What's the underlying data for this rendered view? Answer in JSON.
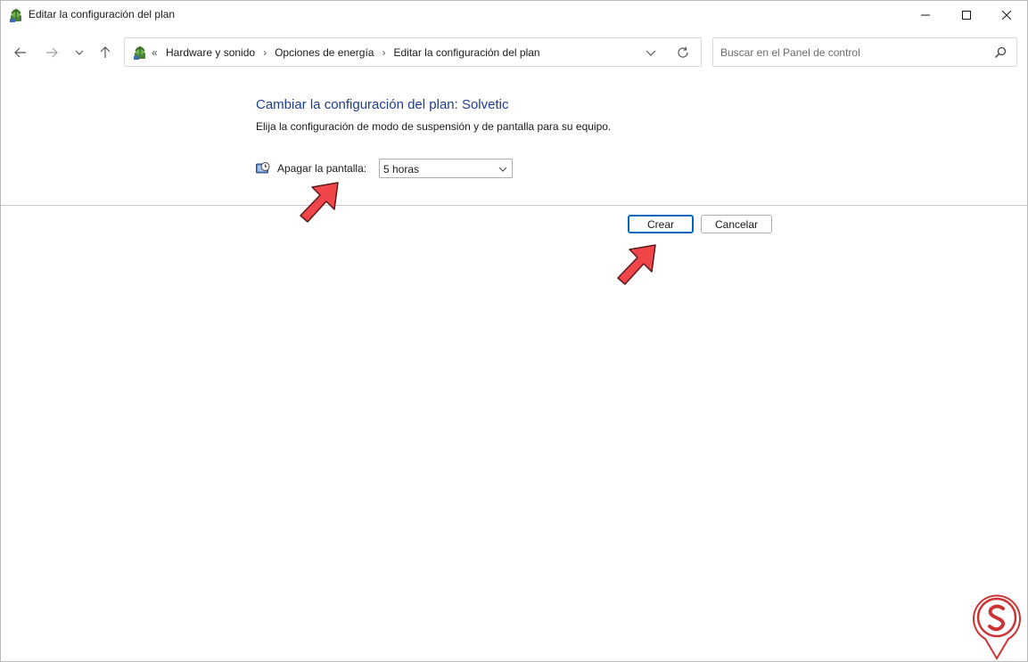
{
  "window": {
    "title": "Editar la configuración del plan"
  },
  "nav": {
    "breadcrumb": [
      "Hardware y sonido",
      "Opciones de energía",
      "Editar la configuración del plan"
    ],
    "search_placeholder": "Buscar en el Panel de control"
  },
  "content": {
    "title": "Cambiar la configuración del plan: Solvetic",
    "subtitle": "Elija la configuración de modo de suspensión y de pantalla para su equipo.",
    "display_label": "Apagar la pantalla:",
    "display_value": "5 horas"
  },
  "buttons": {
    "create": "Crear",
    "cancel": "Cancelar"
  },
  "icons": {
    "app": "control-panel-icon",
    "back": "arrow-left-icon",
    "forward": "arrow-right-icon",
    "recent": "chevron-down-icon",
    "up": "arrow-up-icon",
    "refresh": "refresh-icon",
    "search": "search-icon",
    "display": "clock-monitor-icon"
  },
  "colors": {
    "title_blue": "#1e3d8f",
    "accent": "#0067c0",
    "annotation_arrow": "#f0464a"
  },
  "watermark": {
    "brand": "Solvetic"
  }
}
